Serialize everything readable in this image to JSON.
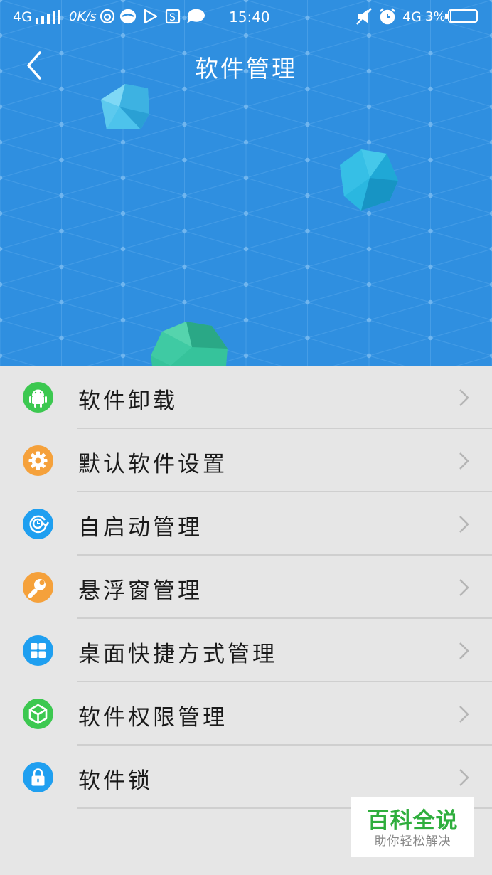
{
  "status_bar": {
    "network": "4G",
    "speed": "0K/s",
    "time": "15:40",
    "network2": "4G",
    "battery": "3%",
    "battery_level": 0.03
  },
  "header": {
    "title": "软件管理"
  },
  "menu": {
    "items": [
      {
        "label": "软件卸载",
        "icon": "android-icon",
        "color": "#3cc850"
      },
      {
        "label": "默认软件设置",
        "icon": "gear-icon",
        "color": "#f5a13b"
      },
      {
        "label": "自启动管理",
        "icon": "clock-refresh-icon",
        "color": "#1f9ff0"
      },
      {
        "label": "悬浮窗管理",
        "icon": "wrench-icon",
        "color": "#f5a13b"
      },
      {
        "label": "桌面快捷方式管理",
        "icon": "grid-icon",
        "color": "#1f9ff0"
      },
      {
        "label": "软件权限管理",
        "icon": "cube-icon",
        "color": "#3cc850"
      },
      {
        "label": "软件锁",
        "icon": "lock-icon",
        "color": "#1f9ff0"
      }
    ]
  },
  "watermark": {
    "main": "百科全说",
    "sub": "助你轻松解决"
  },
  "colors": {
    "header_bg": "#2f8fe0",
    "list_bg": "#e6e6e6"
  }
}
